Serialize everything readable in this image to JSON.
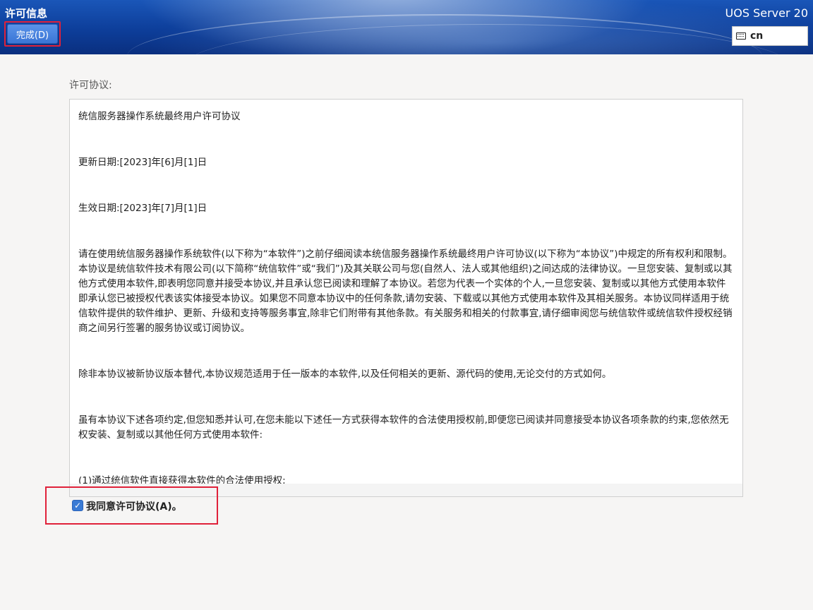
{
  "header": {
    "title": "许可信息",
    "done_button": "完成(D)",
    "product": "UOS Server 20",
    "keyboard_layout": "cn",
    "keyboard_icon": "keyboard-icon"
  },
  "license": {
    "label": "许可协议:",
    "paragraphs": [
      "统信服务器操作系统最终用户许可协议",
      " 更新日期:[2023]年[6]月[1]日",
      " 生效日期:[2023]年[7]月[1]日",
      " 请在使用统信服务器操作系统软件(以下称为“本软件”)之前仔细阅读本统信服务器操作系统最终用户许可协议(以下称为“本协议”)中规定的所有权利和限制。本协议是统信软件技术有限公司(以下简称“统信软件”或“我们”)及其关联公司与您(自然人、法人或其他组织)之间达成的法律协议。一旦您安装、复制或以其他方式使用本软件,即表明您同意并接受本协议,并且承认您已阅读和理解了本协议。若您为代表一个实体的个人,一旦您安装、复制或以其他方式使用本软件即承认您已被授权代表该实体接受本协议。如果您不同意本协议中的任何条款,请勿安装、下载或以其他方式使用本软件及其相关服务。本协议同样适用于统信软件提供的软件维护、更新、升级和支持等服务事宜,除非它们附带有其他条款。有关服务和相关的付款事宜,请仔细审阅您与统信软件或统信软件授权经销商之间另行签署的服务协议或订阅协议。",
      " 除非本协议被新协议版本替代,本协议规范适用于任一版本的本软件,以及任何相关的更新、源代码的使用,无论交付的方式如何。",
      " 虽有本协议下述各项约定,但您知悉并认可,在您未能以下述任一方式获得本软件的合法使用授权前,即便您已阅读并同意接受本协议各项条款的约束,您依然无权安装、复制或以其他任何方式使用本软件:",
      "  (1)通过统信软件直接获得本软件的合法使用授权;"
    ]
  },
  "agree": {
    "checked": true,
    "label": "我同意许可协议(A)。",
    "check_glyph": "✓"
  },
  "colors": {
    "accent": "#3a7bd5",
    "highlight_border": "#e0213a",
    "header_blue": "#0d3e9a"
  }
}
